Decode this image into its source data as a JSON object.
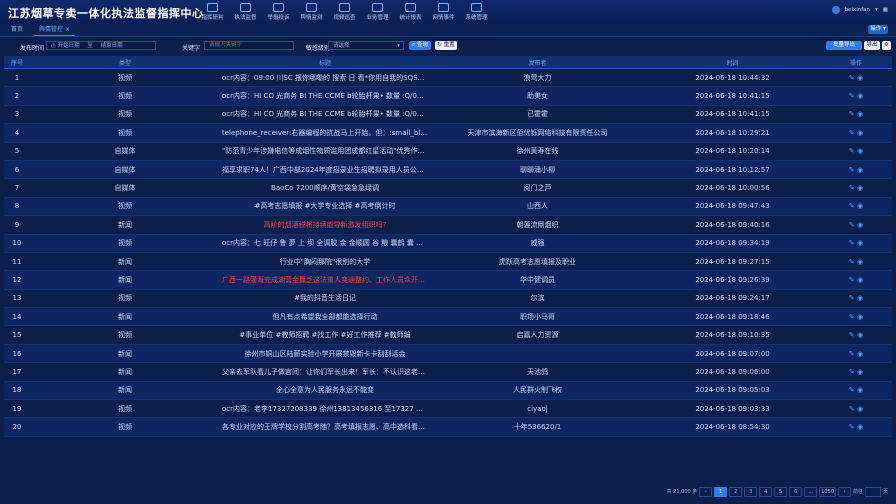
{
  "header": {
    "title": "江苏烟草专卖一体化执法监督指挥中心",
    "nav": [
      {
        "label": "指挥研判"
      },
      {
        "label": "执法监督"
      },
      {
        "label": "举报投诉"
      },
      {
        "label": "舆情监测"
      },
      {
        "label": "视频巡查"
      },
      {
        "label": "业务管理"
      },
      {
        "label": "统计报表"
      },
      {
        "label": "网情事件"
      },
      {
        "label": "系统管理"
      }
    ],
    "user": "beixinfan"
  },
  "tabs": [
    {
      "label": "首页",
      "active": false
    },
    {
      "label": "舆情管控",
      "active": true
    }
  ],
  "tab_menu_label": "操作",
  "filters": {
    "publish_time_label": "发布时间",
    "start_placeholder": "开始日期",
    "range_sep": "至",
    "end_placeholder": "结束日期",
    "keyword_label": "关键字",
    "keyword_placeholder": "请输入关键字",
    "sensitive_label": "敏感级别",
    "sensitive_placeholder": "请选择",
    "search_label": "查询",
    "reset_label": "重置",
    "extra1_label": "批量导出",
    "extra2_label": "导出"
  },
  "table": {
    "headers": [
      "序号",
      "类型",
      "标题",
      "发布者",
      "时间",
      "操作"
    ],
    "rows": [
      {
        "idx": "1",
        "type": "视频",
        "title": "ocr内容：09:00 川SC 报你哪嘞的 搜索 日 看*你用自我的SQS最新报价",
        "author": "浪莺大力",
        "time": "2024-06-18 10:44:32",
        "red": false
      },
      {
        "idx": "2",
        "type": "视频",
        "title": "ocr内容：HI CO 光商务 BI THE CCME b轮胎杆果• 数量 :Q/0725W 排",
        "author": "助美女",
        "time": "2024-06-18 10:41:15",
        "red": false
      },
      {
        "idx": "3",
        "type": "视频",
        "title": "ocr内容：HI CO 光商务 BI THE CCME b轮胎杆果• 数量 :Q/0725W 排",
        "author": "已霍霍",
        "time": "2024-06-18 10:41:15",
        "red": false
      },
      {
        "idx": "4",
        "type": "视频",
        "title": "telephone_receiver:右器编程的抗战马上开始。但：:small_blue_dia",
        "author": "天津市滨海新区佰优铄网络科技有限责任公司",
        "time": "2024-06-18 10:29:21",
        "red": false
      },
      {
        "idx": "5",
        "type": "自媒体",
        "title": "\"防范青少年涉嫌电信等成烟性物质滥用团成都红星活动\"优秀作品展",
        "author": "徐州黄寿在线",
        "time": "2024-06-18 10:20:14",
        "red": false
      },
      {
        "idx": "6",
        "type": "自媒体",
        "title": "福享求职74人！广西中部2024年度招录业生招聘拟录用人员公示【附",
        "author": "聊聊涌小柳",
        "time": "2024-06-18 10:12:57",
        "red": false
      },
      {
        "idx": "7",
        "type": "自媒体",
        "title": "BaoCo 7200顺序/黄空袋急急绿调",
        "author": "阅门之芦",
        "time": "2024-06-18 10:00:56",
        "red": false
      },
      {
        "idx": "8",
        "type": "视频",
        "title": "#高考志愿填报 #大学专业选择 #高考倒计时",
        "author": "山西人",
        "time": "2024-06-18 09:47:43",
        "red": false
      },
      {
        "idx": "9",
        "type": "新闻",
        "title": "高阶的烟酒税将持续能导新激发组织吗?",
        "author": "朝莲流鼎烟织",
        "time": "2024-06-18 09:40:16",
        "red": true
      },
      {
        "idx": "10",
        "type": "视频",
        "title": "ocr内容：七 旺仔 鲁 夢 上 坝 全调胶 金 金顺圆 谷 粮 囊鹤 囊 睦 鲁",
        "author": "威强",
        "time": "2024-06-18 09:34:19",
        "red": false
      },
      {
        "idx": "11",
        "type": "新闻",
        "title": "行业中\"胸闷那院\"很别的大学",
        "author": "虎跃高考志愿填报及职业",
        "time": "2024-06-18 09:27:15",
        "red": false
      },
      {
        "idx": "12",
        "type": "新闻",
        "title": "广西一路灌溉完成湖营金赢乏这法重人变通整约、工作人员众开招能",
        "author": "华中健调员",
        "time": "2024-06-18 09:26:39",
        "red": true
      },
      {
        "idx": "13",
        "type": "视频",
        "title": "#我的抖音生活日记",
        "author": "尔滨",
        "time": "2024-06-18 09:24:17",
        "red": false
      },
      {
        "idx": "14",
        "type": "新闻",
        "title": "但凡有点希望我全部都能选择行动",
        "author": "职场小马哥",
        "time": "2024-06-18 09:18:46",
        "red": false
      },
      {
        "idx": "15",
        "type": "视频",
        "title": "#事业单位 #教师招聘 #找工作 #好工作推荐 #教师编",
        "author": "启嘉人力资源",
        "time": "2024-06-18 09:10:35",
        "red": false
      },
      {
        "idx": "16",
        "type": "新闻",
        "title": "徐州市铜山区陆薪实验小学开展禁毁新卡卡刮刮活会",
        "author": "",
        "time": "2024-06-18 09:07:00",
        "red": false
      },
      {
        "idx": "17",
        "type": "新闻",
        "title": "父亲去军队看儿子做官间：让你们军长出来！军长：不认识这老头！",
        "author": "天池鸽",
        "time": "2024-06-18 09:06:00",
        "red": false
      },
      {
        "idx": "18",
        "type": "新闻",
        "title": "全心全意为人民服务永远不能变",
        "author": "人民群火制飞权",
        "time": "2024-06-18 09:05:03",
        "red": false
      },
      {
        "idx": "19",
        "type": "视频",
        "title": "ocr内容：老李17327208339 徐州13813456316 至17327 茶业 老李",
        "author": "ciyaoj",
        "time": "2024-06-18 09:03:33",
        "red": false
      },
      {
        "idx": "20",
        "type": "视频",
        "title": "各专业对应的王牌学校分割高考随？高考填报志愿、高中选科看过太",
        "author": "十年536620/1",
        "time": "2024-06-18 08:54:30",
        "red": false
      }
    ]
  },
  "pager": {
    "total": "共 21,000 条",
    "pages": [
      "1",
      "2",
      "3",
      "4",
      "5",
      "6",
      "...",
      "1050"
    ],
    "active": "1",
    "goto_label": "前往",
    "page_suffix": "页"
  }
}
